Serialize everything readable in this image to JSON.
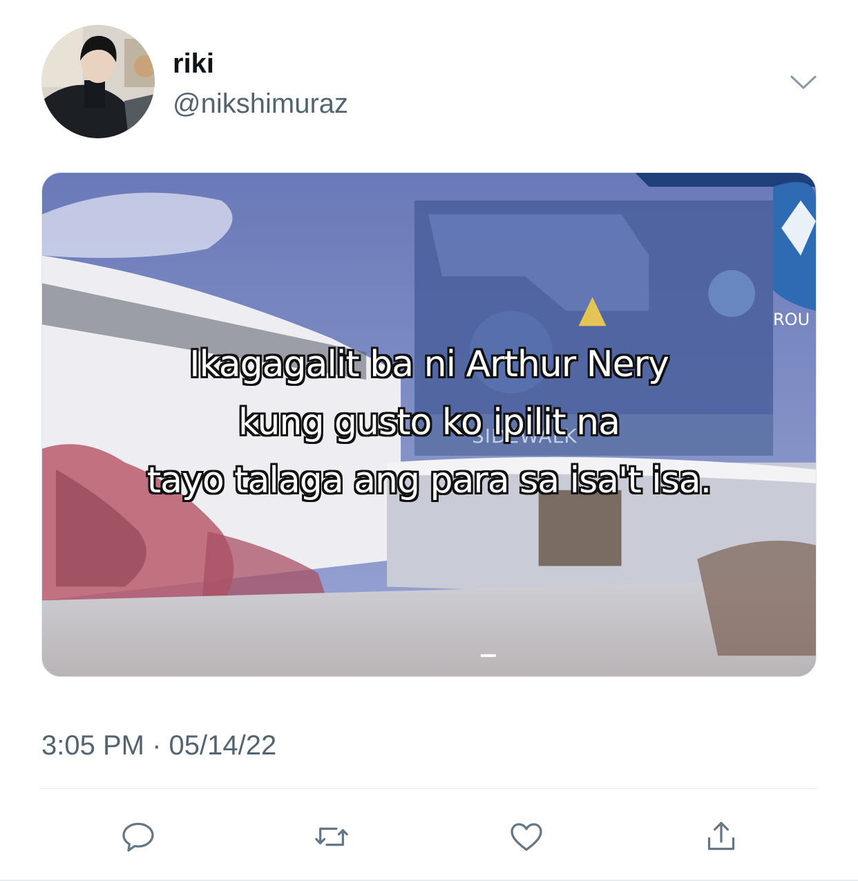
{
  "tweet": {
    "display_name": "riki",
    "handle": "@nikshimuraz",
    "timestamp": "3:05 PM · 05/14/22",
    "more_icon": "chevron-down-icon"
  },
  "media": {
    "caption_lines": [
      "Ikagagalit ba ni Arthur Nery",
      "kung gusto ko ipilit na",
      "tayo talaga ang para sa isa't isa."
    ],
    "background_text": {
      "sidewalk": "SIDEWALK",
      "route": "ROU"
    }
  },
  "actions": {
    "reply_icon": "reply-icon",
    "retweet_icon": "retweet-icon",
    "like_icon": "heart-icon",
    "share_icon": "share-icon"
  },
  "colors": {
    "text_primary": "#0f1419",
    "text_secondary": "#536471",
    "divider": "#e1e8ed"
  }
}
